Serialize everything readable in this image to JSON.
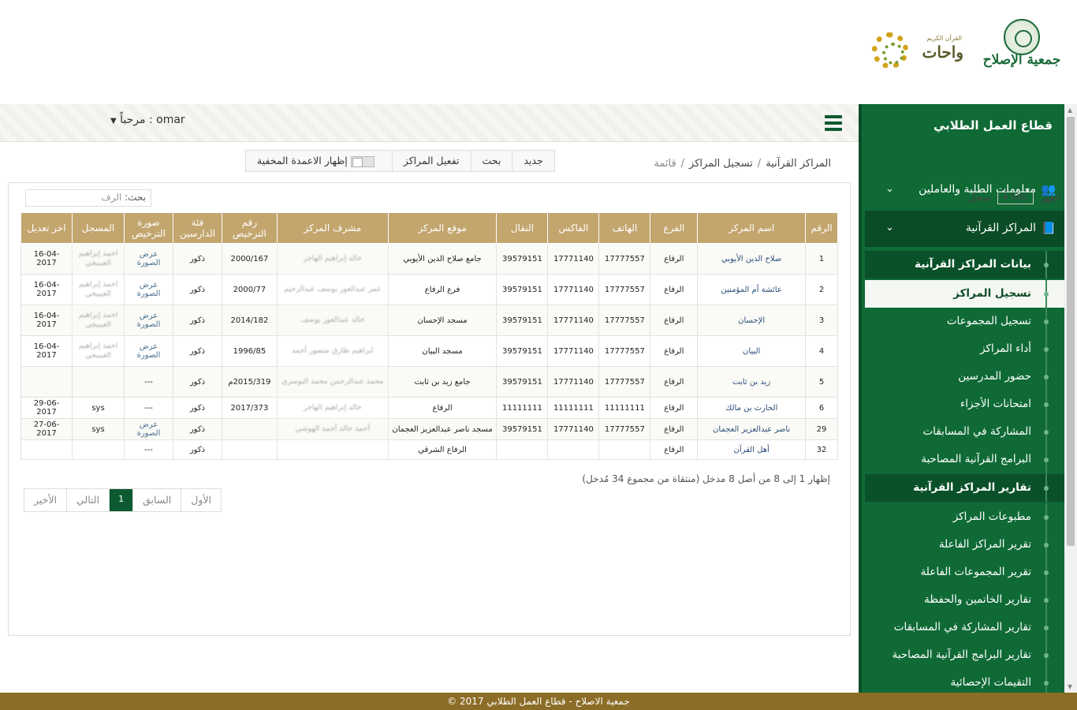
{
  "logos": {
    "islah_name": "جمعية الإصلاح",
    "wahat_small": "القرآن الكريم",
    "wahat_name": "واحات"
  },
  "topbar": {
    "welcome": "مرحباً : omar"
  },
  "sidebar": {
    "title": "قطاع العمل الطلابي",
    "sections": [
      {
        "label": "معلومات الطلبة والعاملين",
        "icon": "users-icon"
      },
      {
        "label": "المراكز القرآنية",
        "icon": "book-icon"
      }
    ],
    "items": [
      {
        "label": "بيانات المراكز القرآنية"
      },
      {
        "label": "تسجيل المراكز"
      },
      {
        "label": "تسجيل المجموعات"
      },
      {
        "label": "أداء المراكز"
      },
      {
        "label": "حضور المدرسين"
      },
      {
        "label": "امتحانات الأجزاء"
      },
      {
        "label": "المشاركة في المسابقات"
      },
      {
        "label": "البرامج القرآنية المصاحبة"
      },
      {
        "label": "تقارير المراكز القرآنية"
      },
      {
        "label": "مطبوعات المراكز"
      },
      {
        "label": "تقرير المراكز الفاعلة"
      },
      {
        "label": "تقرير المجموعات الفاعلة"
      },
      {
        "label": "تقارير الخاتمين والحفظة"
      },
      {
        "label": "تقارير المشاركة في المسابقات"
      },
      {
        "label": "تقارير البرامج القرآنية المصاحبة"
      },
      {
        "label": "التقيمات الإحصائية"
      }
    ]
  },
  "breadcrumb": {
    "level1": "المراكز القرآنية",
    "level2": "تسجيل المراكز",
    "current": "قائمة"
  },
  "toolbar": {
    "new": "جديد",
    "search": "بحث",
    "activate": "تفعيل المراكز",
    "show_hidden": "إظهار الاعمدة المخفية"
  },
  "table_controls": {
    "show_label": "اظهر",
    "page_size": "500",
    "records_label": "سجل",
    "search_label": "بحث:",
    "search_placeholder": "الرف"
  },
  "table": {
    "headers": [
      "الرقم",
      "اسم المركز",
      "الفرع",
      "الهاتف",
      "الفاكس",
      "النقال",
      "موقع المركز",
      "مشرف المركز",
      "رقم الترخيص",
      "فئة الدارسين",
      "صورة الترخيص",
      "المسجل",
      "اخر تعديل"
    ],
    "rows": [
      [
        "1",
        "صلاح الدين الأيوبي",
        "الرفاع",
        "17777557",
        "17771140",
        "39579151",
        "جامع صلاح الدين الأيوبي",
        "خالد إبراهيم الهاجر",
        "2000/167",
        "ذكور",
        "عرض الصورة",
        "احمد إبراهيم الغيبيجي",
        "16-04-2017"
      ],
      [
        "2",
        "عائشة أم المؤمنين",
        "الرفاع",
        "17777557",
        "17771140",
        "39579151",
        "فرع الرفاع",
        "عمر عبدالغور يوسف عبدالرحيم",
        "2000/77",
        "ذكور",
        "عرض الصورة",
        "احمد إبراهيم الغيبيجي",
        "16-04-2017"
      ],
      [
        "3",
        "الإحسان",
        "الرفاع",
        "17777557",
        "17771140",
        "39579151",
        "مسجد الإحسان",
        "خالد عبدالغور يوسف",
        "2014/182",
        "ذكور",
        "عرض الصورة",
        "احمد إبراهيم الغيبيجي",
        "16-04-2017"
      ],
      [
        "4",
        "البيان",
        "الرفاع",
        "17777557",
        "17771140",
        "39579151",
        "مسجد البيان",
        "ابراهيم طارق منصور أحمد",
        "1996/85",
        "ذكور",
        "عرض الصورة",
        "احمد إبراهيم الغيبيجي",
        "16-04-2017"
      ],
      [
        "5",
        "زيد بن ثابت",
        "الرفاع",
        "17777557",
        "17771140",
        "39579151",
        "جامع زيد بن ثابت",
        "محمد عبدالرحمن محمد البوسري",
        "2015/319م",
        "ذكور",
        "---",
        "",
        ""
      ],
      [
        "6",
        "الحارث بن مالك",
        "الرفاع",
        "11111111",
        "11111111",
        "11111111",
        "الرفاع",
        "خالد إبراهيم الهاجر",
        "2017/373",
        "ذكور",
        "---",
        "sys",
        "29-06-2017"
      ],
      [
        "29",
        "ناصر عبدالعزيز العجمان",
        "الرفاع",
        "17777557",
        "17771140",
        "39579151",
        "مسجد ناصر عبدالعزيز العجمان",
        "أحمد خالد أحمد الهوشي",
        "",
        "ذكور",
        "عرض الصورة",
        "sys",
        "27-06-2017"
      ],
      [
        "32",
        "أهل القرآن",
        "الرفاع",
        "",
        "",
        "",
        "الرفاع الشرقي",
        "",
        "",
        "ذكور",
        "---",
        "",
        ""
      ]
    ]
  },
  "info": "إظهار 1 إلى 8 من أصل 8 مدخل (منتقاة من مجموع 34 مُدخل)",
  "pager": {
    "first": "الأول",
    "prev": "السابق",
    "current": "1",
    "next": "التالي",
    "last": "الأخير"
  },
  "footer": "© 2017 جمعية الاصلاح - قطاع العمل الطلابي",
  "colors": {
    "sidebar_green": "#0f6a36",
    "table_header_gold": "#c3a56e",
    "footer_brown": "#8c6d27"
  }
}
